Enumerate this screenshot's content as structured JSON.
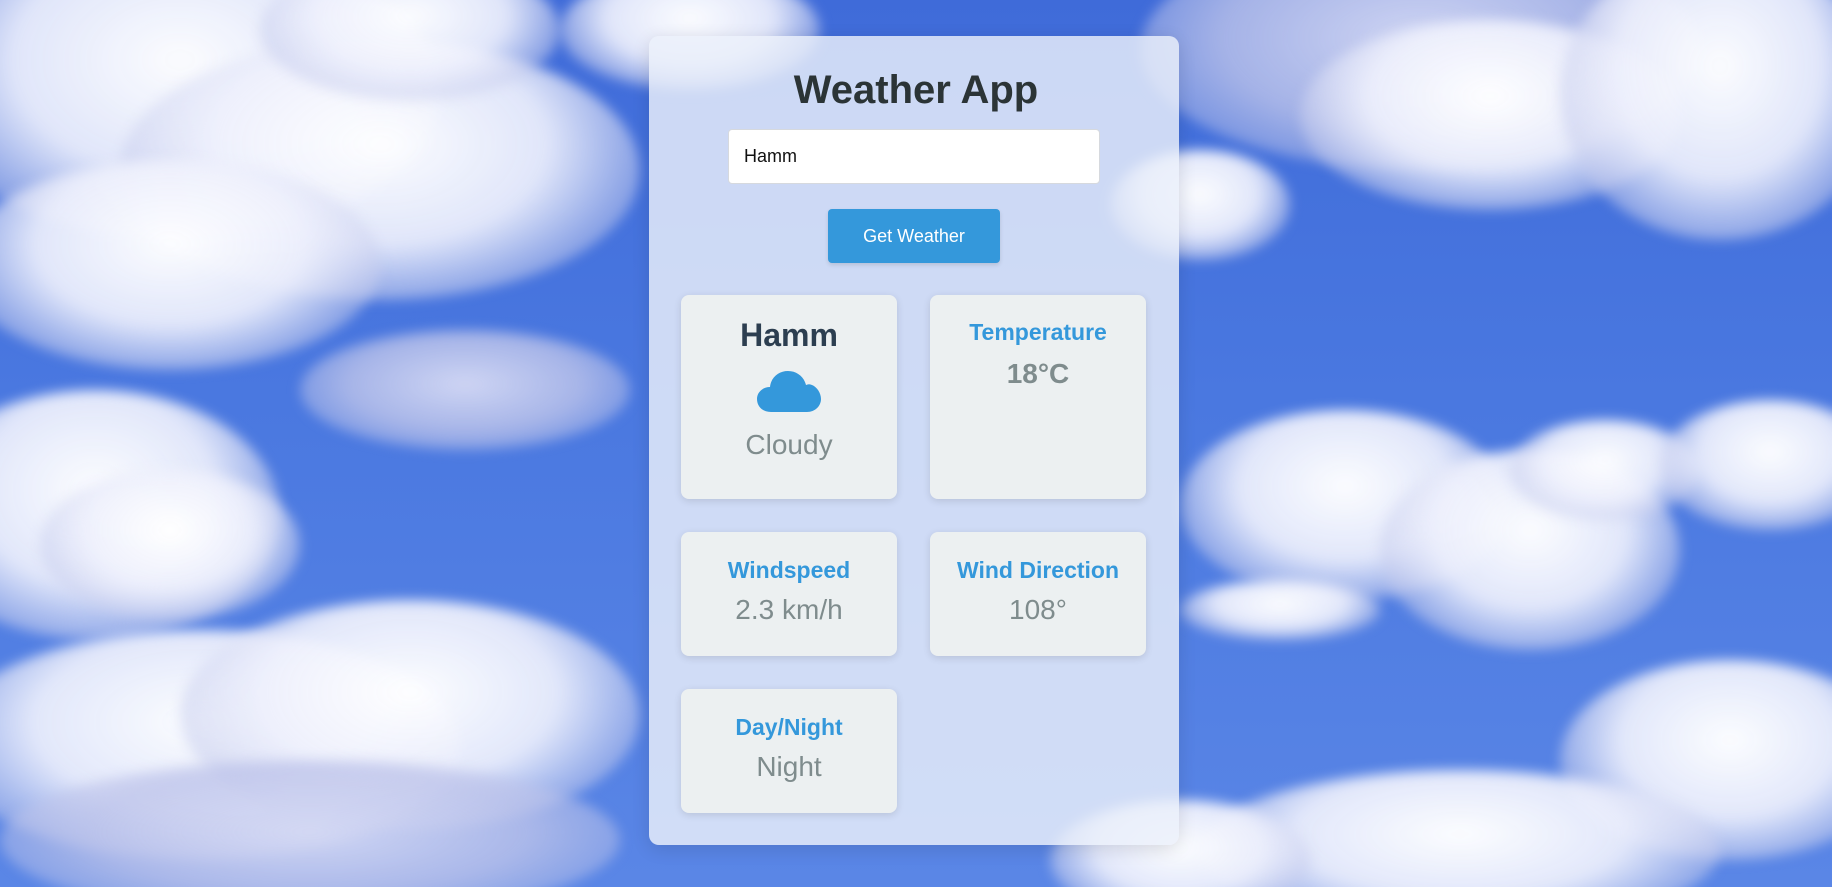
{
  "app": {
    "title": "Weather App"
  },
  "search": {
    "value": "Hamm",
    "placeholder": ""
  },
  "actions": {
    "get_weather_label": "Get Weather"
  },
  "location_card": {
    "city": "Hamm",
    "icon": "cloud-icon",
    "condition": "Cloudy"
  },
  "temperature_card": {
    "label": "Temperature",
    "value": "18°C"
  },
  "windspeed_card": {
    "label": "Windspeed",
    "value": "2.3 km/h"
  },
  "wind_direction_card": {
    "label": "Wind Direction",
    "value": "108°"
  },
  "day_night_card": {
    "label": "Day/Night",
    "value": "Night"
  },
  "colors": {
    "accent": "#3498db",
    "card_background": "#ecf0f1",
    "heading": "#2c3e50",
    "muted_text": "#7f8c8d"
  }
}
